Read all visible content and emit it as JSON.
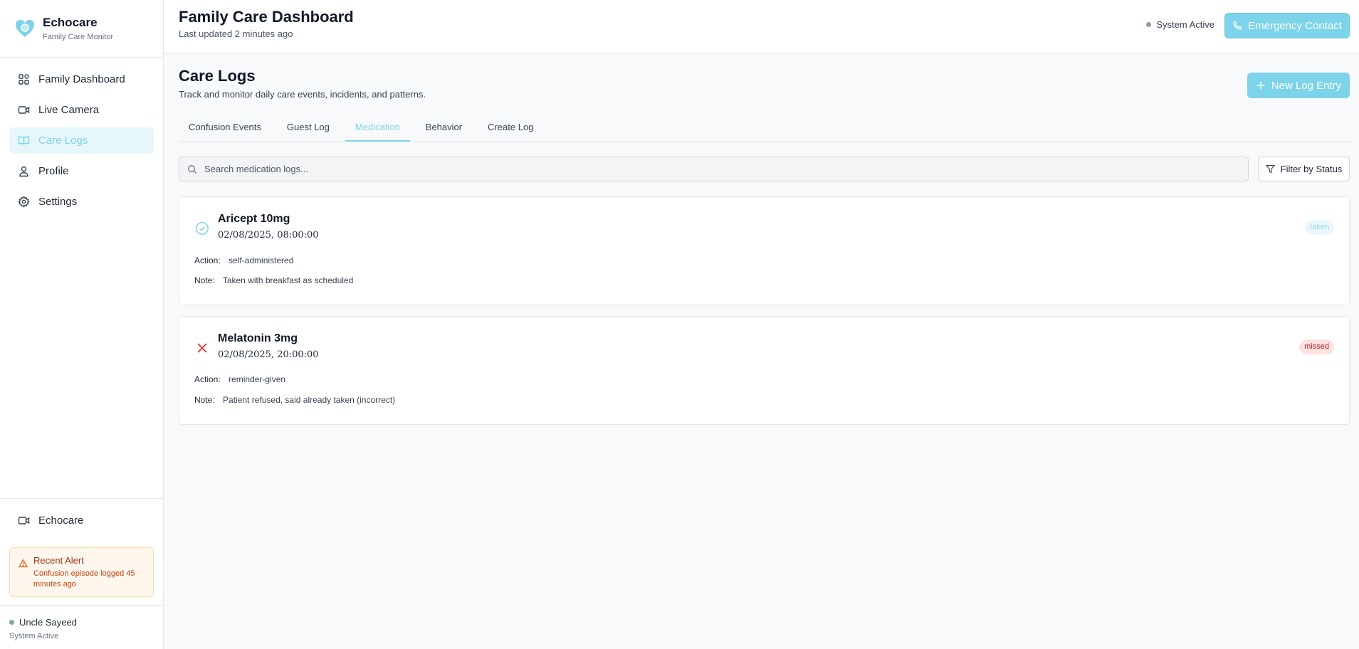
{
  "app": {
    "name": "Echocare",
    "subtitle": "Family Care Monitor"
  },
  "sidebar": {
    "items": [
      {
        "label": "Family Dashboard",
        "icon": "grid-icon"
      },
      {
        "label": "Live Camera",
        "icon": "video-camera-icon"
      },
      {
        "label": "Care Logs",
        "icon": "book-icon",
        "active": true
      },
      {
        "label": "Profile",
        "icon": "user-icon"
      },
      {
        "label": "Settings",
        "icon": "gear-icon"
      }
    ],
    "bottom_link": "Echocare",
    "alert": {
      "title": "Recent Alert",
      "text": "Confusion episode logged 45 minutes ago"
    },
    "user": {
      "name": "Uncle Sayeed",
      "status": "System Active"
    }
  },
  "header": {
    "title": "Family Care Dashboard",
    "subtitle": "Last updated 2 minutes ago",
    "system_status": "System Active",
    "emergency_label": "Emergency Contact"
  },
  "main": {
    "title": "Care Logs",
    "subtitle": "Track and monitor daily care events, incidents, and patterns.",
    "new_log_label": "New Log Entry",
    "tabs": [
      "Confusion Events",
      "Guest Log",
      "Medication",
      "Behavior",
      "Create Log"
    ],
    "active_tab": "Medication",
    "search_placeholder": "Search medication logs...",
    "filter_label": "Filter by Status",
    "logs": [
      {
        "name": "Aricept 10mg",
        "time": "02/08/2025, 08:00:00",
        "status": "taken",
        "action_label": "Action:",
        "action": "self-administered",
        "note_label": "Note:",
        "note": "Taken with breakfast as scheduled"
      },
      {
        "name": "Melatonin 3mg",
        "time": "02/08/2025, 20:00:00",
        "status": "missed",
        "action_label": "Action:",
        "action": "reminder-given",
        "note_label": "Note:",
        "note": "Patient refused, said already taken (incorrect)"
      }
    ]
  },
  "colors": {
    "accent": "#7dd3ea",
    "active_bg": "#e6f7fc",
    "missed": "#dc2626",
    "alert_bg": "#fff7ed",
    "status_dot": "#84a98c"
  }
}
